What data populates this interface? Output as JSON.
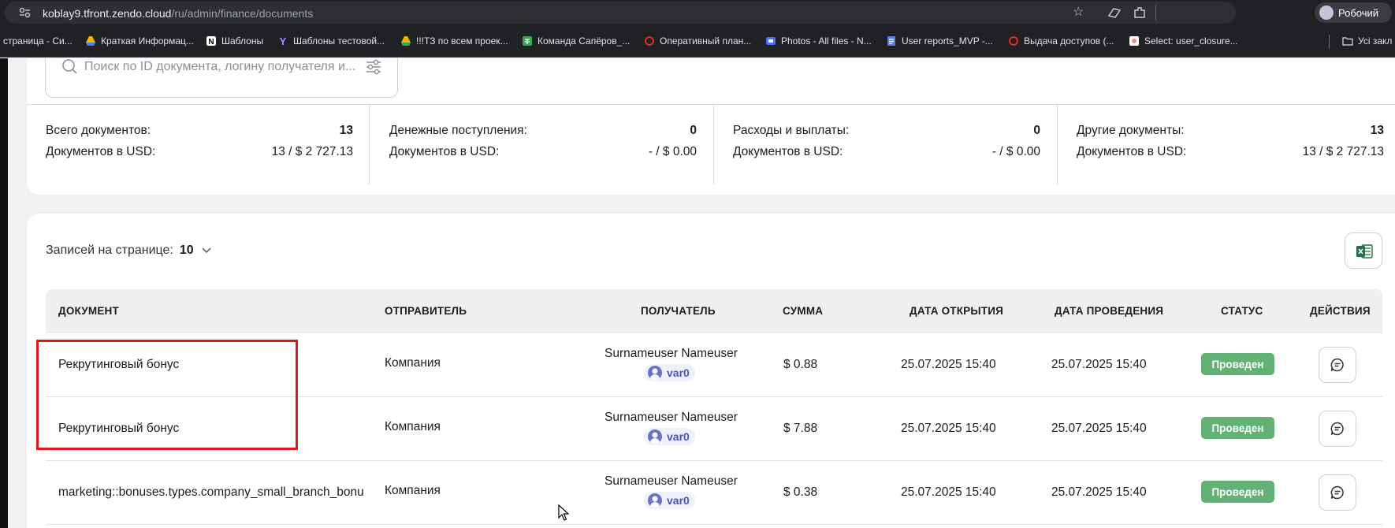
{
  "browser": {
    "url_host": "koblay9.tfront.zendo.cloud",
    "url_path": "/ru/admin/finance/documents",
    "profile_name": "Робочий",
    "bookmarks": [
      {
        "label": "страница - Си...",
        "icon_color": "#ffffff"
      },
      {
        "label": "Краткая Информац...",
        "icon_color": "#f4b400"
      },
      {
        "label": "Шаблоны",
        "icon_color": "#ffffff"
      },
      {
        "label": "Шаблоны тестовой...",
        "icon_color": "#7b3fe4"
      },
      {
        "label": "!!!ТЗ по всем проек...",
        "icon_color": "#f4b400"
      },
      {
        "label": "Команда Сапёров_...",
        "icon_color": "#34a853"
      },
      {
        "label": "Оперативный план...",
        "icon_color": "#d93025"
      },
      {
        "label": "Photos - All files - N...",
        "icon_color": "#4c6ef5"
      },
      {
        "label": "User reports_MVP -...",
        "icon_color": "#5b7cf5"
      },
      {
        "label": "Выдача доступов (...",
        "icon_color": "#d93025"
      },
      {
        "label": "Select: user_closure...",
        "icon_color": "#f28b82"
      }
    ],
    "bookmarks_folder": "Усі закл"
  },
  "search": {
    "placeholder": "Поиск по ID документа, логину получателя и..."
  },
  "stats": [
    {
      "total_label": "Всего документов:",
      "total_value": "13",
      "usd_label": "Документов в USD:",
      "usd_value": "13 / $ 2 727.13"
    },
    {
      "total_label": "Денежные поступления:",
      "total_value": "0",
      "usd_label": "Документов в USD:",
      "usd_value": "- / $ 0.00"
    },
    {
      "total_label": "Расходы и выплаты:",
      "total_value": "0",
      "usd_label": "Документов в USD:",
      "usd_value": "- / $ 0.00"
    },
    {
      "total_label": "Другие документы:",
      "total_value": "13",
      "usd_label": "Документов в USD:",
      "usd_value": "13 / $ 2 727.13"
    }
  ],
  "pagination": {
    "per_page_label": "Записей на странице:",
    "per_page_value": "10"
  },
  "table": {
    "headers": {
      "document": "ДОКУМЕНТ",
      "sender": "ОТПРАВИТЕЛЬ",
      "recipient": "ПОЛУЧАТЕЛЬ",
      "amount": "СУММА",
      "opened": "ДАТА ОТКРЫТИЯ",
      "posted": "ДАТА ПРОВЕДЕНИЯ",
      "status": "СТАТУС",
      "actions": "ДЕЙСТВИЯ"
    },
    "rows": [
      {
        "document": "Рекрутинговый бонус",
        "sender": "Компания",
        "recipient_name": "Surnameuser Nameuser",
        "recipient_login": "var0",
        "amount": "$ 0.88",
        "opened": "25.07.2025 15:40",
        "posted": "25.07.2025 15:40",
        "status": "Проведен"
      },
      {
        "document": "Рекрутинговый бонус",
        "sender": "Компания",
        "recipient_name": "Surnameuser Nameuser",
        "recipient_login": "var0",
        "amount": "$ 7.88",
        "opened": "25.07.2025 15:40",
        "posted": "25.07.2025 15:40",
        "status": "Проведен"
      },
      {
        "document": "marketing::bonuses.types.company_small_branch_bonu",
        "sender": "Компания",
        "recipient_name": "Surnameuser Nameuser",
        "recipient_login": "var0",
        "amount": "$ 0.38",
        "opened": "25.07.2025 15:40",
        "posted": "25.07.2025 15:40",
        "status": "Проведен"
      }
    ]
  },
  "colors": {
    "status_success": "#62b275",
    "highlight": "#e0161b",
    "login_chip": "#4a55b8"
  }
}
